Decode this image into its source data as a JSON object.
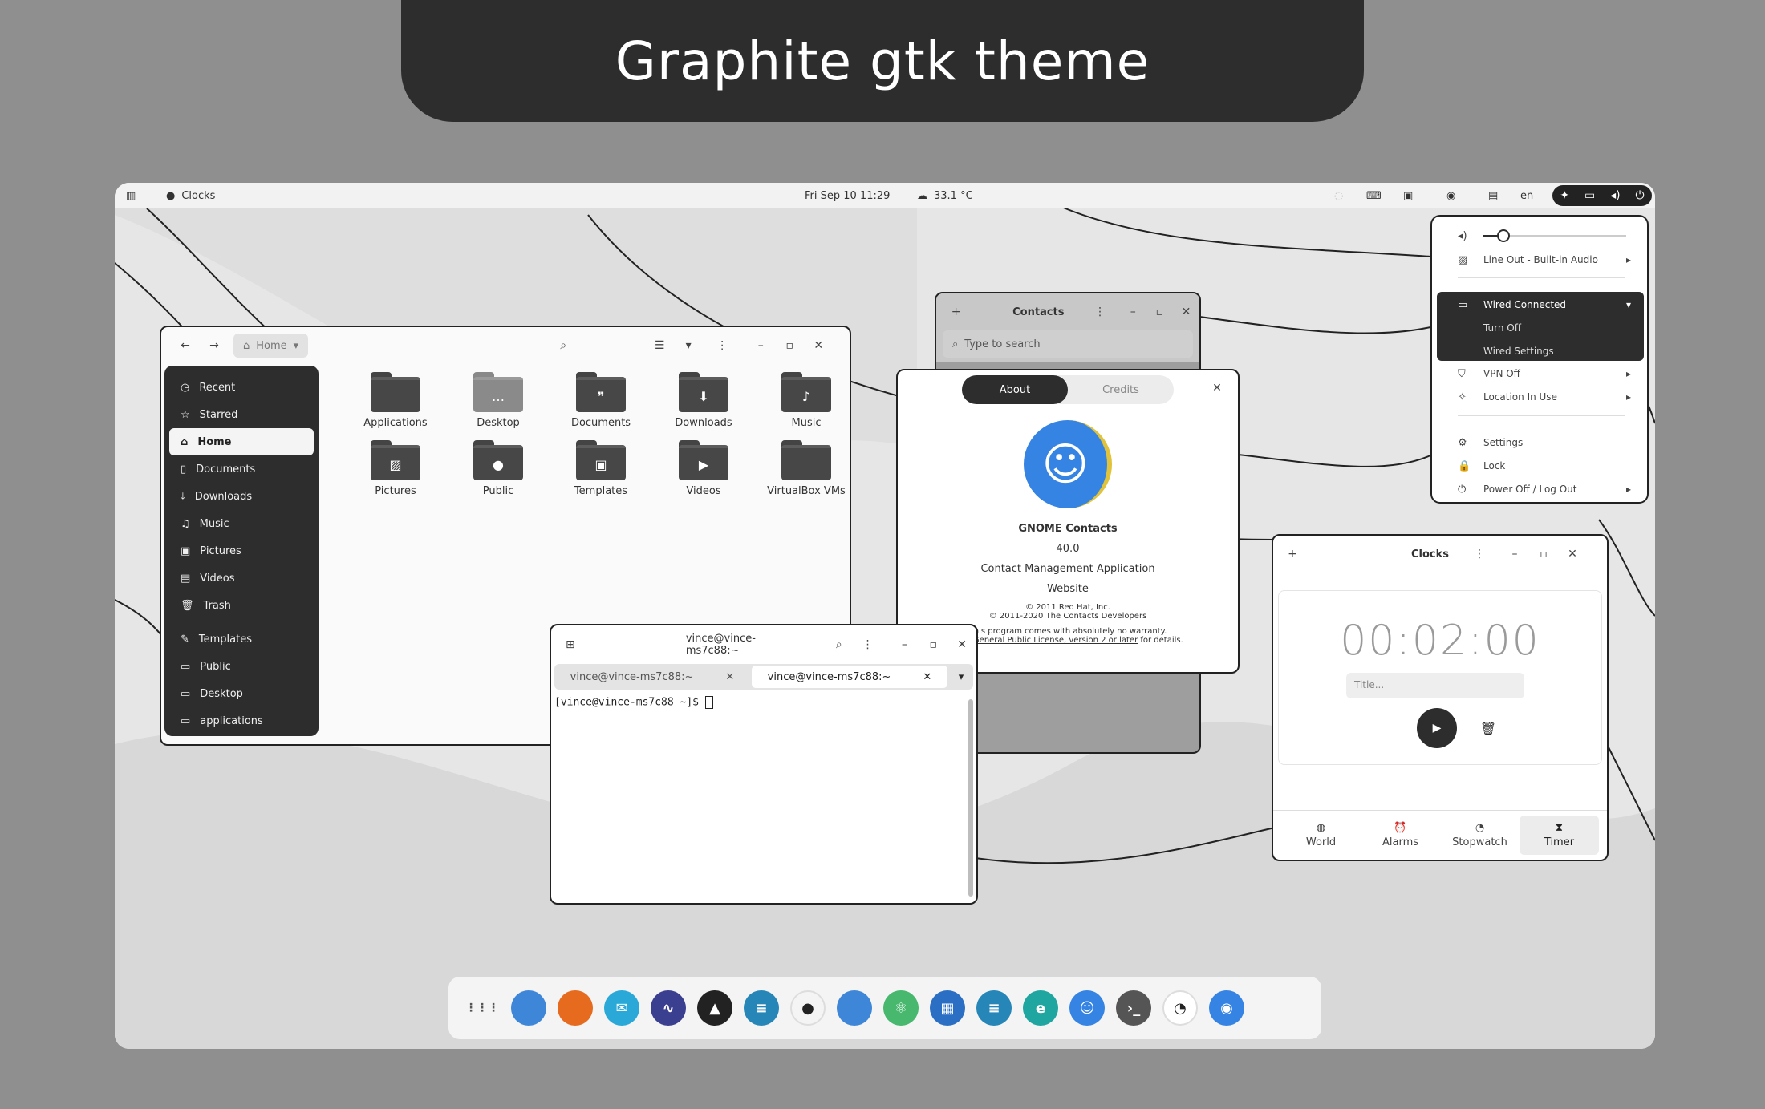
{
  "banner": {
    "title": "Graphite gtk theme"
  },
  "topbar": {
    "activities_icon": "activities-icon",
    "app_name": "Clocks",
    "datetime": "Fri Sep 10  11:29",
    "weather": "33.1 °C",
    "language": "en"
  },
  "files": {
    "location": "Home",
    "sidebar": [
      {
        "label": "Recent",
        "icon": "clock-icon"
      },
      {
        "label": "Starred",
        "icon": "star-icon"
      },
      {
        "label": "Home",
        "icon": "home-icon",
        "active": true
      },
      {
        "label": "Documents",
        "icon": "document-icon"
      },
      {
        "label": "Downloads",
        "icon": "download-icon"
      },
      {
        "label": "Music",
        "icon": "music-icon"
      },
      {
        "label": "Pictures",
        "icon": "picture-icon"
      },
      {
        "label": "Videos",
        "icon": "video-icon"
      },
      {
        "label": "Trash",
        "icon": "trash-icon"
      },
      {
        "label": "Templates",
        "icon": "template-icon"
      },
      {
        "label": "Public",
        "icon": "folder-icon"
      },
      {
        "label": "Desktop",
        "icon": "folder-icon"
      },
      {
        "label": "applications",
        "icon": "folder-icon"
      }
    ],
    "folders": [
      {
        "label": "Applications",
        "glyph": ""
      },
      {
        "label": "Desktop",
        "glyph": "…"
      },
      {
        "label": "Documents",
        "glyph": "❞"
      },
      {
        "label": "Downloads",
        "glyph": "⬇"
      },
      {
        "label": "Music",
        "glyph": "♪"
      },
      {
        "label": "Pictures",
        "glyph": "▨"
      },
      {
        "label": "Public",
        "glyph": "●"
      },
      {
        "label": "Templates",
        "glyph": "▣"
      },
      {
        "label": "Videos",
        "glyph": "▶"
      },
      {
        "label": "VirtualBox VMs",
        "glyph": ""
      }
    ]
  },
  "contacts": {
    "title": "Contacts",
    "search_placeholder": "Type to search"
  },
  "about": {
    "tab_about": "About",
    "tab_credits": "Credits",
    "app_name": "GNOME Contacts",
    "version": "40.0",
    "description": "Contact Management Application",
    "website": "Website",
    "copyright1": "© 2011 Red Hat, Inc.",
    "copyright2": "© 2011-2020 The Contacts Developers",
    "warranty": "This program comes with absolutely no warranty.",
    "license_link": "GNU General Public License, version 2 or later",
    "license_suffix": " for details."
  },
  "terminal": {
    "title": "vince@vince-ms7c88:~",
    "tabs": [
      "vince@vince-ms7c88:~",
      "vince@vince-ms7c88:~"
    ],
    "prompt": "[vince@vince-ms7c88 ~]$ "
  },
  "clocks": {
    "title": "Clocks",
    "timer": "00:02:00",
    "title_placeholder": "Title...",
    "tabs": [
      {
        "label": "World",
        "icon": "globe-icon"
      },
      {
        "label": "Alarms",
        "icon": "alarm-icon"
      },
      {
        "label": "Stopwatch",
        "icon": "stopwatch-icon"
      },
      {
        "label": "Timer",
        "icon": "hourglass-icon",
        "active": true
      }
    ]
  },
  "system_menu": {
    "volume": 0.14,
    "audio_output": "Line Out - Built-in Audio",
    "wired": "Wired Connected",
    "turn_off": "Turn Off",
    "wired_settings": "Wired Settings",
    "vpn": "VPN Off",
    "location": "Location In Use",
    "settings": "Settings",
    "lock": "Lock",
    "power": "Power Off / Log Out"
  },
  "colors": {
    "accent_dark": "#2d2d2d",
    "contacts_blue": "#3584e4",
    "banner_bg": "#2d2d2d"
  },
  "dock": {
    "apps": [
      {
        "name": "app-grid-icon",
        "color": "transparent",
        "glyph": "⋮⋮⋮"
      },
      {
        "name": "files-icon",
        "color": "#3d86d8",
        "glyph": ""
      },
      {
        "name": "firefox-icon",
        "color": "#e66b1e",
        "glyph": ""
      },
      {
        "name": "mail-icon",
        "color": "#2aa8d8",
        "glyph": "✉"
      },
      {
        "name": "monitor-icon",
        "color": "#3b3f8f",
        "glyph": "∿"
      },
      {
        "name": "inkscape-icon",
        "color": "#222222",
        "glyph": "▲"
      },
      {
        "name": "tweaks-icon",
        "color": "#2786b8",
        "glyph": "≡"
      },
      {
        "name": "github-icon",
        "color": "#f4f4f4",
        "glyph": "●"
      },
      {
        "name": "folder-icon",
        "color": "#3d86d8",
        "glyph": ""
      },
      {
        "name": "atom-icon",
        "color": "#47b86e",
        "glyph": "⚛"
      },
      {
        "name": "vscode-icon",
        "color": "#2a6fc4",
        "glyph": "▦"
      },
      {
        "name": "settings-icon",
        "color": "#2786b8",
        "glyph": "≡"
      },
      {
        "name": "edge-icon",
        "color": "#1fa6a0",
        "glyph": "e"
      },
      {
        "name": "contacts-icon",
        "color": "#3584e4",
        "glyph": "☺"
      },
      {
        "name": "terminal-icon",
        "color": "#555555",
        "glyph": "›_"
      },
      {
        "name": "clocks-icon",
        "color": "#ffffff",
        "glyph": "◔"
      },
      {
        "name": "toggle-icon",
        "color": "#3584e4",
        "glyph": "◉"
      }
    ]
  }
}
